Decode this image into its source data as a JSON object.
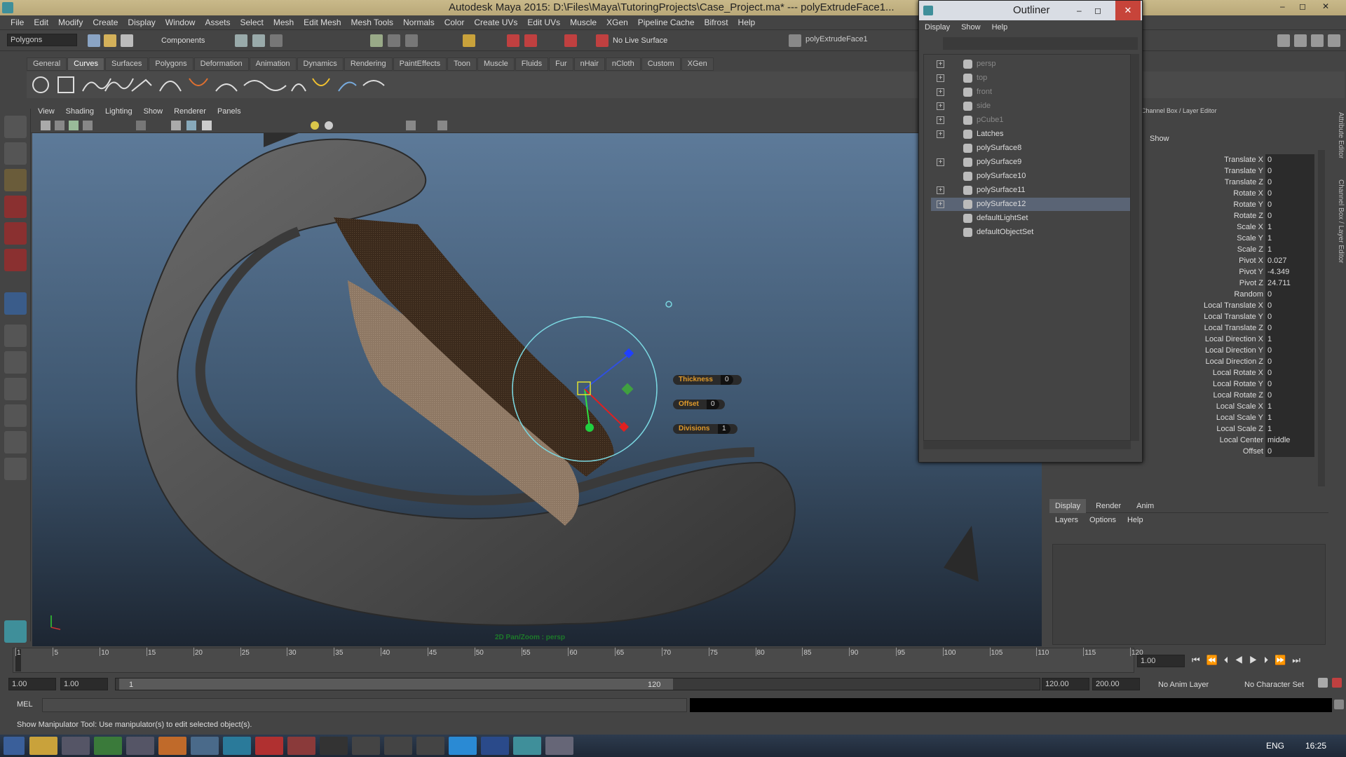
{
  "window": {
    "title": "Autodesk Maya 2015: D:\\Files\\Maya\\TutoringProjects\\Case_Project.ma*   ---   polyExtrudeFace1...",
    "min": "–",
    "max": "◻",
    "close": "✕"
  },
  "menubar": [
    "File",
    "Edit",
    "Modify",
    "Create",
    "Display",
    "Window",
    "Assets",
    "Select",
    "Mesh",
    "Edit Mesh",
    "Mesh Tools",
    "Normals",
    "Color",
    "Create UVs",
    "Edit UVs",
    "Muscle",
    "XGen",
    "Pipeline Cache",
    "Bifrost",
    "Help"
  ],
  "statusline": {
    "mode": "Polygons",
    "components_label": "Components",
    "live_surface": "No Live Surface",
    "selected_name": "polyExtrudeFace1"
  },
  "shelf_tabs": [
    "General",
    "Curves",
    "Surfaces",
    "Polygons",
    "Deformation",
    "Animation",
    "Dynamics",
    "Rendering",
    "PaintEffects",
    "Toon",
    "Muscle",
    "Fluids",
    "Fur",
    "nHair",
    "nCloth",
    "Custom",
    "XGen"
  ],
  "shelf_active": "Curves",
  "panel_menu": [
    "View",
    "Shading",
    "Lighting",
    "Show",
    "Renderer",
    "Panels"
  ],
  "viewport": {
    "labels": [
      {
        "name": "Thickness",
        "value": "0"
      },
      {
        "name": "Offset",
        "value": "0"
      },
      {
        "name": "Divisions",
        "value": "1"
      }
    ],
    "hud_text": "2D Pan/Zoom : persp"
  },
  "outliner": {
    "title": "Outliner",
    "menu": [
      "Display",
      "Show",
      "Help"
    ],
    "items": [
      {
        "name": "persp",
        "expand": true,
        "dim": true,
        "selected": false
      },
      {
        "name": "top",
        "expand": true,
        "dim": true,
        "selected": false
      },
      {
        "name": "front",
        "expand": true,
        "dim": true,
        "selected": false
      },
      {
        "name": "side",
        "expand": true,
        "dim": true,
        "selected": false
      },
      {
        "name": "pCube1",
        "expand": true,
        "dim": true,
        "selected": false
      },
      {
        "name": "Latches",
        "expand": true,
        "dim": false,
        "selected": false
      },
      {
        "name": "polySurface8",
        "expand": false,
        "dim": false,
        "selected": false
      },
      {
        "name": "polySurface9",
        "expand": true,
        "dim": false,
        "selected": false
      },
      {
        "name": "polySurface10",
        "expand": false,
        "dim": false,
        "selected": false
      },
      {
        "name": "polySurface11",
        "expand": true,
        "dim": false,
        "selected": false
      },
      {
        "name": "polySurface12",
        "expand": true,
        "dim": false,
        "selected": true
      },
      {
        "name": "defaultLightSet",
        "expand": false,
        "dim": false,
        "selected": false
      },
      {
        "name": "defaultObjectSet",
        "expand": false,
        "dim": false,
        "selected": false
      }
    ]
  },
  "channel_box": {
    "title": "Channel Box / Layer Editor",
    "show_label": "Show",
    "attributes": [
      {
        "name": "Translate X",
        "value": "0"
      },
      {
        "name": "Translate Y",
        "value": "0"
      },
      {
        "name": "Translate Z",
        "value": "0"
      },
      {
        "name": "Rotate X",
        "value": "0"
      },
      {
        "name": "Rotate Y",
        "value": "0"
      },
      {
        "name": "Rotate Z",
        "value": "0"
      },
      {
        "name": "Scale X",
        "value": "1"
      },
      {
        "name": "Scale Y",
        "value": "1"
      },
      {
        "name": "Scale Z",
        "value": "1"
      },
      {
        "name": "Pivot X",
        "value": "0.027"
      },
      {
        "name": "Pivot Y",
        "value": "-4.349"
      },
      {
        "name": "Pivot Z",
        "value": "24.711"
      },
      {
        "name": "Random",
        "value": "0"
      },
      {
        "name": "Local Translate X",
        "value": "0"
      },
      {
        "name": "Local Translate Y",
        "value": "0"
      },
      {
        "name": "Local Translate Z",
        "value": "0"
      },
      {
        "name": "Local Direction X",
        "value": "1"
      },
      {
        "name": "Local Direction Y",
        "value": "0"
      },
      {
        "name": "Local Direction Z",
        "value": "0"
      },
      {
        "name": "Local Rotate X",
        "value": "0"
      },
      {
        "name": "Local Rotate Y",
        "value": "0"
      },
      {
        "name": "Local Rotate Z",
        "value": "0"
      },
      {
        "name": "Local Scale X",
        "value": "1"
      },
      {
        "name": "Local Scale Y",
        "value": "1"
      },
      {
        "name": "Local Scale Z",
        "value": "1"
      },
      {
        "name": "Local Center",
        "value": "middle"
      },
      {
        "name": "Offset",
        "value": "0"
      }
    ],
    "side_tabs": [
      "Attribute Editor",
      "Channel Box / Layer Editor"
    ]
  },
  "layer_editor": {
    "tabs": [
      "Display",
      "Render",
      "Anim"
    ],
    "menu": [
      "Layers",
      "Options",
      "Help"
    ]
  },
  "timeline": {
    "ticks": [
      "1",
      "5",
      "10",
      "15",
      "20",
      "25",
      "30",
      "35",
      "40",
      "45",
      "50",
      "55",
      "60",
      "65",
      "70",
      "75",
      "80",
      "85",
      "90",
      "95",
      "100",
      "105",
      "110",
      "115",
      "120"
    ],
    "current_frame": "1.00"
  },
  "range": {
    "start": "1.00",
    "playback_start": "1.00",
    "slider_start": "1",
    "slider_end": "120",
    "playback_end": "120.00",
    "end": "200.00",
    "anim_layer": "No Anim Layer",
    "char_set": "No Character Set"
  },
  "cmdline": {
    "label": "MEL"
  },
  "helpline": "Show Manipulator Tool: Use manipulator(s) to edit selected object(s).",
  "taskbar": {
    "lang": "ENG",
    "time": "16:25"
  }
}
